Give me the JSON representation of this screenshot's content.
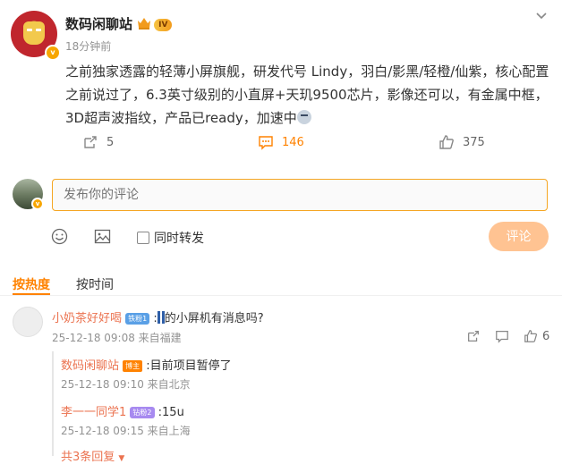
{
  "post": {
    "author": "数码闲聊站",
    "level_badge": "IV",
    "verified_badge": "v",
    "time": "18分钟前",
    "text_line1": "之前独家透露的轻薄小屏旗舰，研发代号 Lindy，羽白/影黑/轻橙/仙紫，核心配置",
    "text_line2": "之前说过了，6.3英寸级别的小直屏+天玑9500芯片，影像还可以，有金属中框，",
    "text_line3": "3D超声波指纹，产品已ready，加速中",
    "repost_count": "5",
    "comment_count": "146",
    "like_count": "375"
  },
  "compose": {
    "placeholder": "发布你的评论",
    "also_repost_label": "同时转发",
    "submit_label": "评论"
  },
  "sort_tabs": {
    "hot": "按热度",
    "time": "按时间"
  },
  "comments": [
    {
      "name": "小奶茶好好喝",
      "tag": "铁粉1",
      "text": "的小屏机有消息吗?",
      "meta": "25-12-18 09:08 来自福建",
      "like_count": "6",
      "replies": [
        {
          "name": "数码闲聊站",
          "tag": "博主",
          "text": ":目前项目暂停了",
          "meta": "25-12-18 09:10 来自北京"
        },
        {
          "name": "李一一同学1",
          "tag": "钻粉2",
          "text": ":15u",
          "meta": "25-12-18 09:15 来自上海"
        }
      ],
      "more_replies": "共3条回复"
    }
  ],
  "colors": {
    "accent": "#ff8200",
    "comment_name": "#eb7350",
    "input_border": "#f5a623",
    "submit_bg": "#ffc392"
  }
}
